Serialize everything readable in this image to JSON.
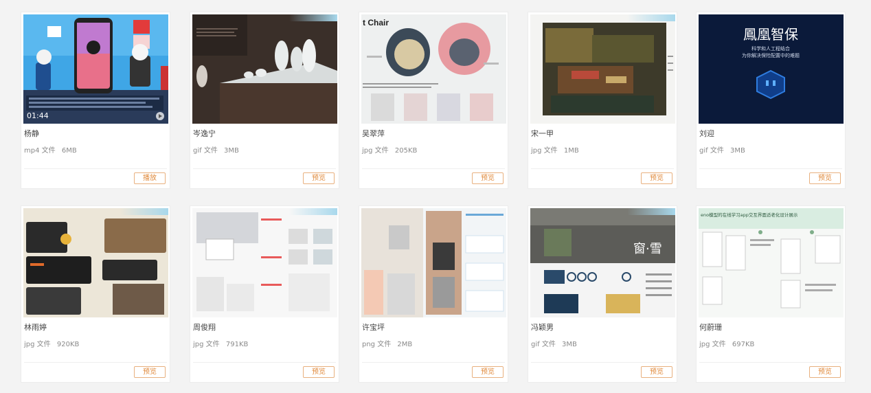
{
  "file_type_label": "文件",
  "cards": [
    {
      "name": "杨静",
      "ext": "mp4",
      "size": "6MB",
      "action": "播放",
      "duration": "01:44"
    },
    {
      "name": "岑逸宁",
      "ext": "gif",
      "size": "3MB",
      "action": "预览"
    },
    {
      "name": "吴翠萍",
      "ext": "jpg",
      "size": "205KB",
      "action": "预览"
    },
    {
      "name": "宋一甲",
      "ext": "jpg",
      "size": "1MB",
      "action": "预览"
    },
    {
      "name": "刘迎",
      "ext": "gif",
      "size": "3MB",
      "action": "预览"
    },
    {
      "name": "林雨婷",
      "ext": "jpg",
      "size": "920KB",
      "action": "预览"
    },
    {
      "name": "周俊翔",
      "ext": "jpg",
      "size": "791KB",
      "action": "预览"
    },
    {
      "name": "许宝坪",
      "ext": "png",
      "size": "2MB",
      "action": "预览"
    },
    {
      "name": "冯颖男",
      "ext": "gif",
      "size": "3MB",
      "action": "预览"
    },
    {
      "name": "何蔚珊",
      "ext": "jpg",
      "size": "697KB",
      "action": "预览"
    }
  ],
  "thumb_text": {
    "chair_title": "t Chair",
    "phoenix_title": "鳳凰智保",
    "phoenix_sub1": "科学和人工程结合",
    "phoenix_sub2": "为你解决保险配置中的难题",
    "window_text": "窗·雪",
    "app_title": "eno模型的在线学习app交互界面适老化设计展示"
  }
}
